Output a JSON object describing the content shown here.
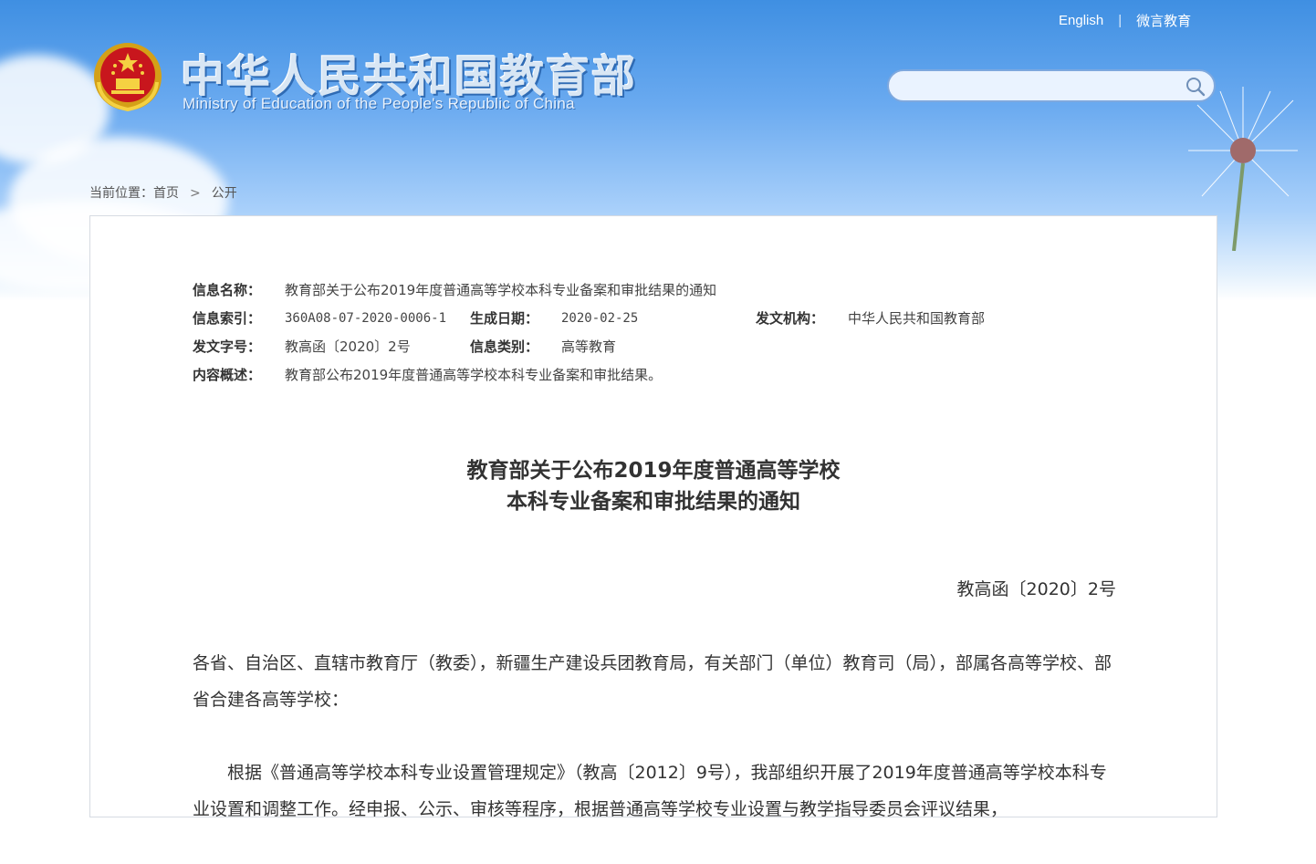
{
  "header": {
    "links": [
      "English",
      "微言教育"
    ],
    "title_cn": "中华人民共和国教育部",
    "title_en": "Ministry of Education of the People's Republic of China",
    "search": {
      "placeholder": "",
      "value": ""
    }
  },
  "breadcrumb": {
    "prefix": "当前位置：",
    "items": [
      "首页",
      "公开"
    ]
  },
  "meta": {
    "name_label": "信息名称：",
    "name_value": "教育部关于公布2019年度普通高等学校本科专业备案和审批结果的通知",
    "index_label": "信息索引：",
    "index_value": "360A08-07-2020-0006-1",
    "date_label": "生成日期：",
    "date_value": "2020-02-25",
    "org_label": "发文机构：",
    "org_value": "中华人民共和国教育部",
    "docno_label": "发文字号：",
    "docno_value": "教高函〔2020〕2号",
    "category_label": "信息类别：",
    "category_value": "高等教育",
    "summary_label": "内容概述：",
    "summary_value": "教育部公布2019年度普通高等学校本科专业备案和审批结果。"
  },
  "document": {
    "title_line1": "教育部关于公布2019年度普通高等学校",
    "title_line2": "本科专业备案和审批结果的通知",
    "number": "教高函〔2020〕2号",
    "addressee": "各省、自治区、直辖市教育厅（教委），新疆生产建设兵团教育局，有关部门（单位）教育司（局），部属各高等学校、部省合建各高等学校：",
    "paragraph1": "根据《普通高等学校本科专业设置管理规定》（教高〔2012〕9号），我部组织开展了2019年度普通高等学校本科专业设置和调整工作。经申报、公示、审核等程序，根据普通高等学校专业设置与教学指导委员会评议结果，"
  },
  "colors": {
    "sky_top": "#3f8fe2",
    "border": "#d6dbe2",
    "text": "#333333"
  }
}
